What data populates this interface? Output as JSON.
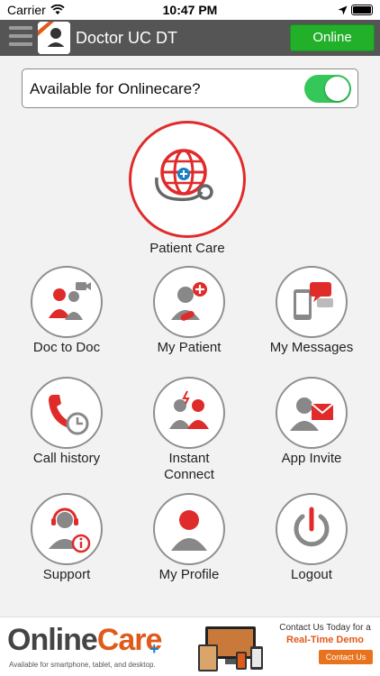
{
  "status_bar": {
    "carrier": "Carrier",
    "time": "10:47 PM"
  },
  "header": {
    "title": "Doctor UC DT",
    "status_button": "Online",
    "logo_text": "OnlineCare"
  },
  "availability": {
    "label": "Available for Onlinecare?",
    "enabled": true
  },
  "hero": {
    "label": "Patient Care",
    "icon": "globe-stethoscope-icon"
  },
  "tiles": [
    {
      "label": "Doc to Doc",
      "icon": "doctors-video-icon"
    },
    {
      "label": "My Patient",
      "icon": "patient-pills-icon"
    },
    {
      "label": "My Messages",
      "icon": "phone-chat-icon"
    },
    {
      "label": "Call history",
      "icon": "phone-clock-icon"
    },
    {
      "label": "Instant\nConnect",
      "icon": "doctors-connect-icon"
    },
    {
      "label": "App Invite",
      "icon": "user-envelope-icon"
    },
    {
      "label": "Support",
      "icon": "headset-info-icon"
    },
    {
      "label": "My Profile",
      "icon": "user-profile-icon"
    },
    {
      "label": "Logout",
      "icon": "power-icon"
    }
  ],
  "banner": {
    "brand_online": "Online",
    "brand_care": "Care",
    "tagline": "Available for smartphone, tablet, and desktop.",
    "contact_line1": "Contact Us Today for a",
    "contact_line2": "Real-Time Demo",
    "contact_button": "Contact Us"
  },
  "colors": {
    "accent_red": "#e02b2b",
    "online_green": "#22b02a",
    "toggle_green": "#35c759",
    "nav_gray": "#555555"
  }
}
